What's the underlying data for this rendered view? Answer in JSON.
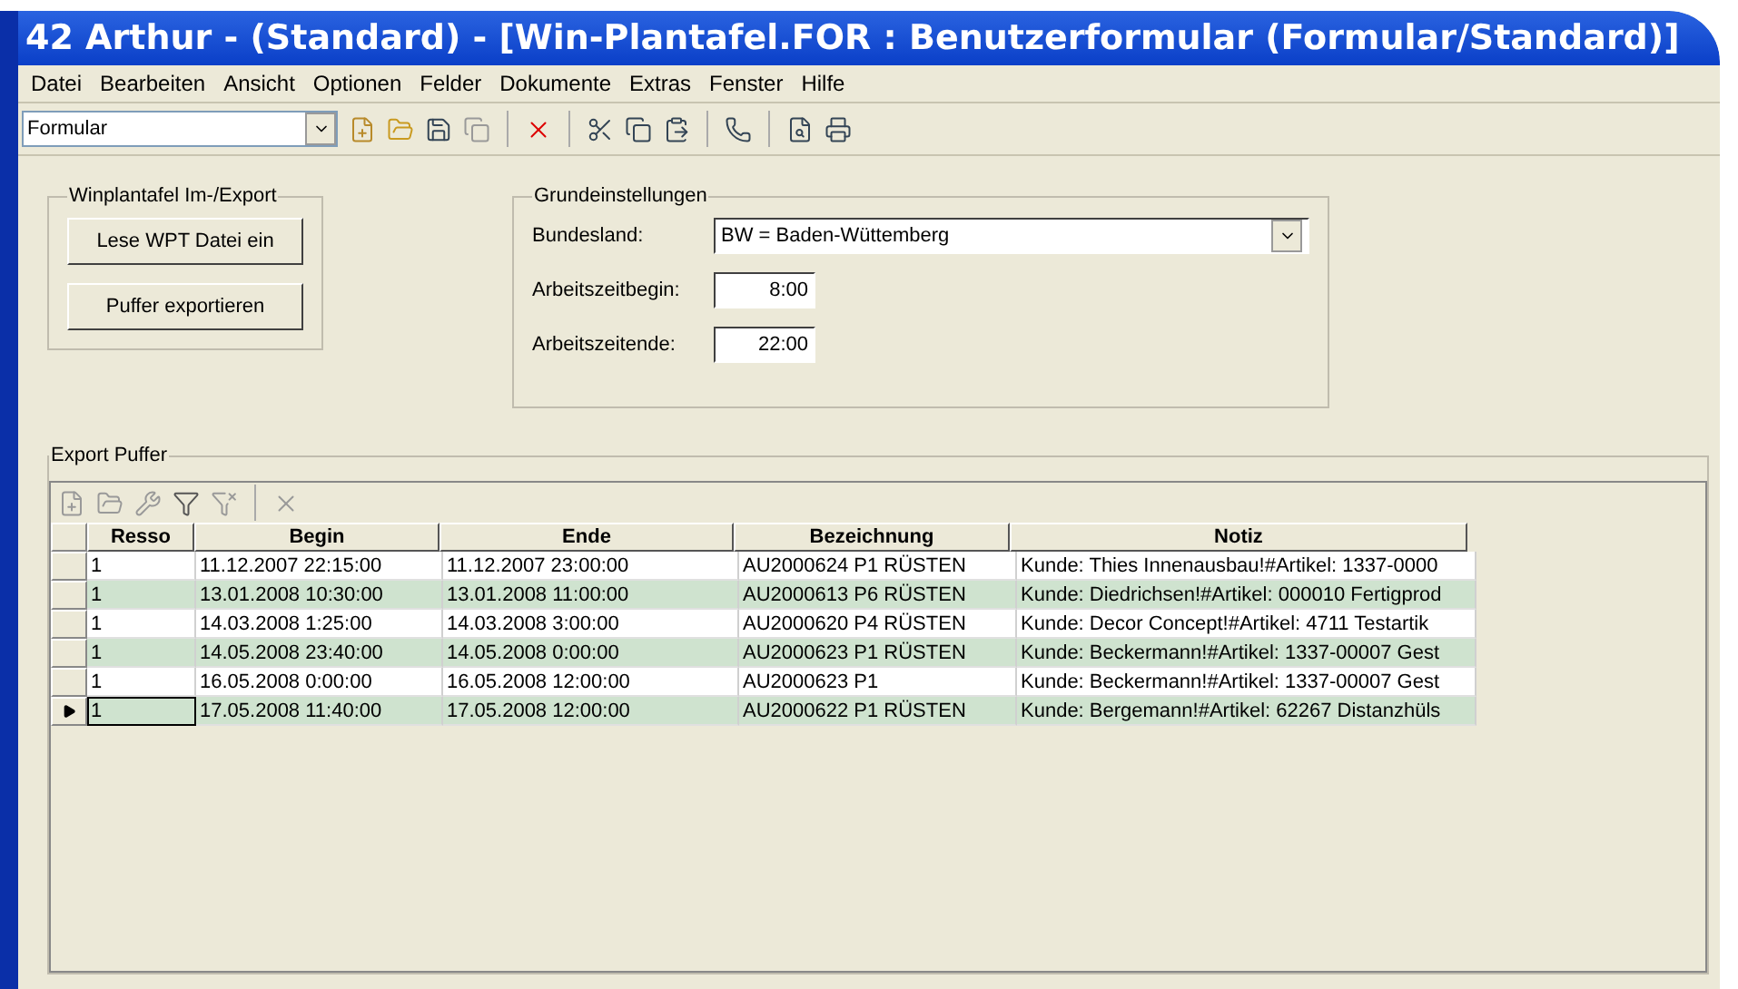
{
  "window": {
    "title": "42 Arthur -  (Standard) - [Win-Plantafel.FOR : Benutzerformular (Formular/Standard)]"
  },
  "menu": [
    "Datei",
    "Bearbeiten",
    "Ansicht",
    "Optionen",
    "Felder",
    "Dokumente",
    "Extras",
    "Fenster",
    "Hilfe"
  ],
  "toolbar": {
    "form_select": "Formular"
  },
  "import_export": {
    "title": "Winplantafel Im-/Export",
    "buttons": [
      "Lese WPT Datei ein",
      "Puffer exportieren"
    ]
  },
  "settings": {
    "title": "Grundeinstellungen",
    "state_label": "Bundesland:",
    "state_value": "BW = Baden-Wüttemberg",
    "start_label": "Arbeitszeitbegin:",
    "start_value": "8:00",
    "end_label": "Arbeitszeitende:",
    "end_value": "22:00"
  },
  "export_buffer": {
    "title": "Export Puffer",
    "columns": [
      "Resso",
      "Begin",
      "Ende",
      "Bezeichnung",
      "Notiz"
    ],
    "rows": [
      {
        "cells": [
          "1",
          "11.12.2007 22:15:00",
          "11.12.2007 23:00:00",
          "AU2000624 P1 RÜSTEN",
          "Kunde: Thies Innenausbau!#Artikel: 1337-0000"
        ],
        "selected": false
      },
      {
        "cells": [
          "1",
          "13.01.2008 10:30:00",
          "13.01.2008 11:00:00",
          "AU2000613 P6 RÜSTEN",
          "Kunde: Diedrichsen!#Artikel: 000010 Fertigprod"
        ],
        "selected": false
      },
      {
        "cells": [
          "1",
          "14.03.2008 1:25:00",
          "14.03.2008 3:00:00",
          "AU2000620 P4 RÜSTEN",
          "Kunde: Decor Concept!#Artikel: 4711 Testartik"
        ],
        "selected": false
      },
      {
        "cells": [
          "1",
          "14.05.2008 23:40:00",
          "14.05.2008 0:00:00",
          "AU2000623 P1 RÜSTEN",
          "Kunde: Beckermann!#Artikel: 1337-00007 Gest"
        ],
        "selected": false
      },
      {
        "cells": [
          "1",
          "16.05.2008 0:00:00",
          "16.05.2008 12:00:00",
          "AU2000623 P1",
          "Kunde: Beckermann!#Artikel: 1337-00007 Gest"
        ],
        "selected": false
      },
      {
        "cells": [
          "1",
          "17.05.2008 11:40:00",
          "17.05.2008 12:00:00",
          "AU2000622 P1 RÜSTEN",
          "Kunde: Bergemann!#Artikel: 62267 Distanzhüls"
        ],
        "selected": true
      }
    ]
  }
}
